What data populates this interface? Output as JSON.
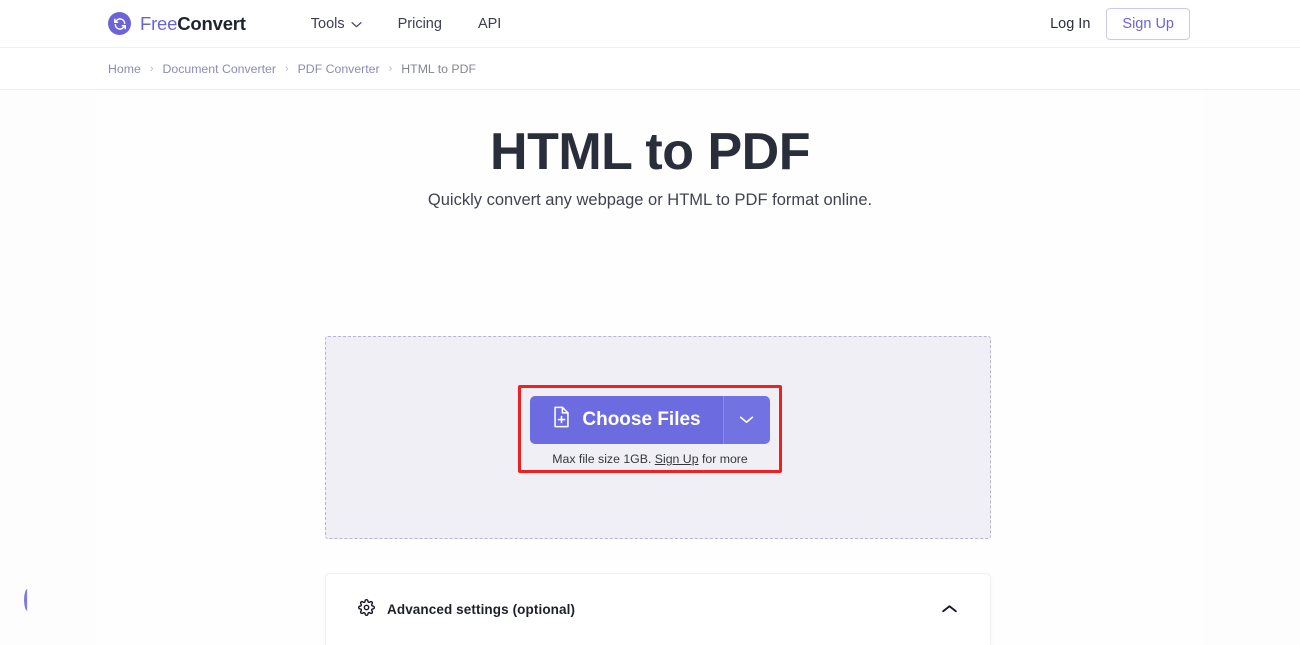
{
  "header": {
    "brand": {
      "part1": "Free",
      "part2": "Convert",
      "icon": "refresh-circle-icon"
    },
    "nav": [
      {
        "label": "Tools",
        "has_caret": true
      },
      {
        "label": "Pricing",
        "has_caret": false
      },
      {
        "label": "API",
        "has_caret": false
      }
    ],
    "login_label": "Log In",
    "signup_label": "Sign Up"
  },
  "breadcrumb": {
    "items": [
      {
        "label": "Home",
        "current": false
      },
      {
        "label": "Document Converter",
        "current": false
      },
      {
        "label": "PDF Converter",
        "current": false
      },
      {
        "label": "HTML to PDF",
        "current": true
      }
    ],
    "separator": "›"
  },
  "hero": {
    "title": "HTML to PDF",
    "subtitle": "Quickly convert any webpage or HTML to PDF format online."
  },
  "upload": {
    "choose_files_label": "Choose Files",
    "file_icon": "file-plus-icon",
    "dropdown_icon": "chevron-down-icon",
    "max_size_prefix": "Max file size 1GB. ",
    "max_size_link": "Sign Up",
    "max_size_suffix": " for more"
  },
  "advanced": {
    "label": "Advanced settings (optional)",
    "gear_icon": "gear-icon",
    "toggle_icon": "chevron-up-icon"
  },
  "colors": {
    "brand_purple": "#6c63d8",
    "button_purple": "#6c6ce0",
    "annotation_red": "#ef2020",
    "dropzone_fill": "#f0eff5",
    "heading_dark": "#2a2d3a"
  }
}
